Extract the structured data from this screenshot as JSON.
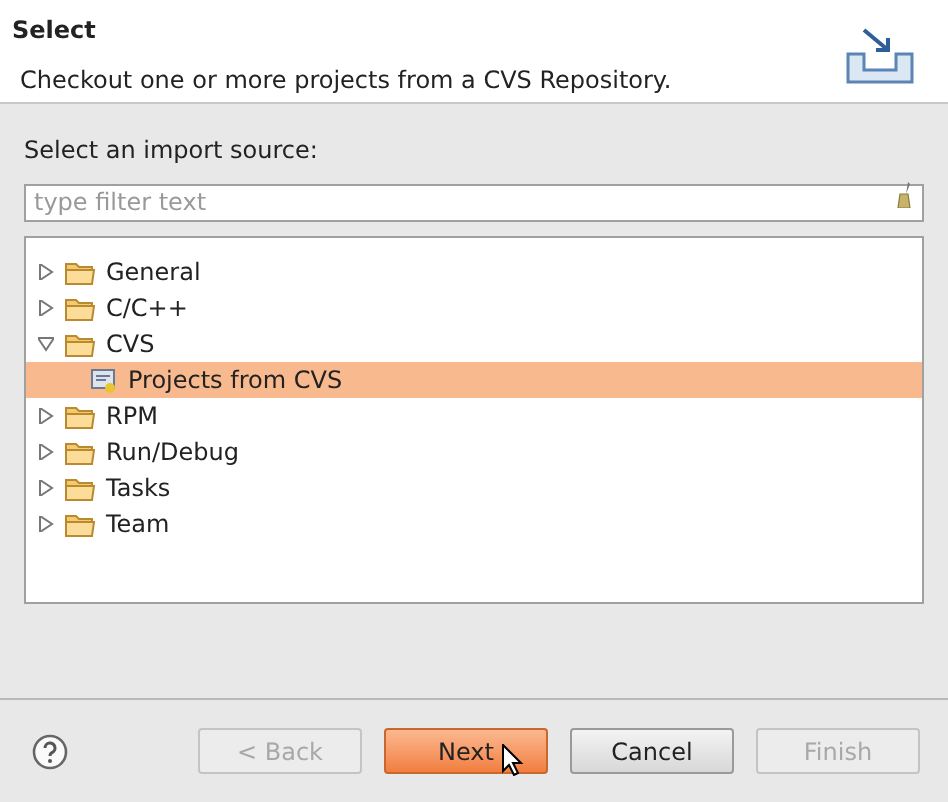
{
  "header": {
    "title": "Select",
    "description": "Checkout one or more projects from a CVS Repository."
  },
  "source_label": "Select an import source:",
  "filter": {
    "placeholder": "type filter text"
  },
  "tree": [
    {
      "label": "General",
      "expanded": false,
      "selected": false
    },
    {
      "label": "C/C++",
      "expanded": false,
      "selected": false
    },
    {
      "label": "CVS",
      "expanded": true,
      "selected": false,
      "children": [
        {
          "label": "Projects from CVS",
          "selected": true
        }
      ]
    },
    {
      "label": "RPM",
      "expanded": false,
      "selected": false
    },
    {
      "label": "Run/Debug",
      "expanded": false,
      "selected": false
    },
    {
      "label": "Tasks",
      "expanded": false,
      "selected": false
    },
    {
      "label": "Team",
      "expanded": false,
      "selected": false
    }
  ],
  "buttons": [
    {
      "label": "< Back",
      "disabled": true,
      "default": false
    },
    {
      "label": "Next",
      "disabled": false,
      "default": true
    },
    {
      "label": "Cancel",
      "disabled": false,
      "default": false
    },
    {
      "label": "Finish",
      "disabled": true,
      "default": false
    }
  ]
}
